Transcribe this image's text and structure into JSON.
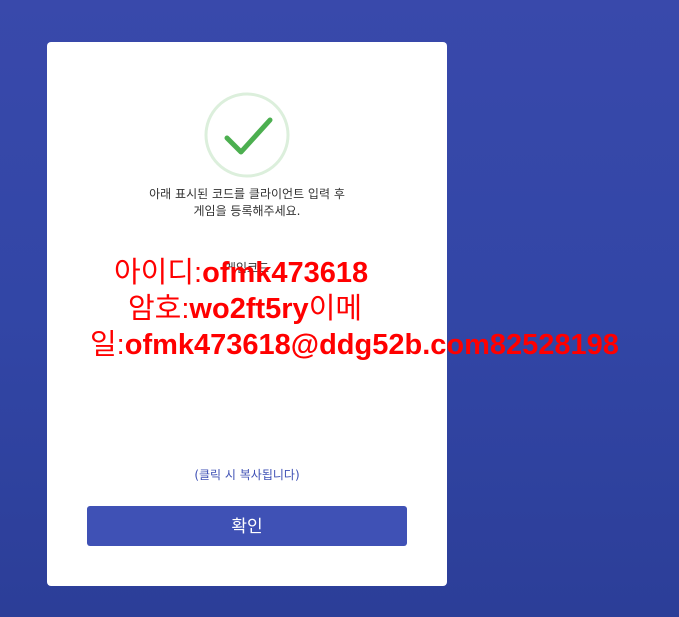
{
  "dialog": {
    "icon": "check-circle-icon",
    "instruction_line1": "아래 표시된 코드를 클라이언트 입력 후",
    "instruction_line2": "게임을 등록해주세요.",
    "code_label": "게임코드",
    "credentials": {
      "id_label": "아이디:",
      "id_value": "ofmk473618",
      "pw_label": "암호:",
      "pw_value": "wo2ft5ry",
      "email_label_part1": "이메",
      "email_label_part2": "일:",
      "email_value": "ofmk473618@ddg52b.com82528198"
    },
    "copy_hint": "(클릭 시 복사됩니다)",
    "confirm_label": "확인"
  },
  "colors": {
    "background": "#3246a6",
    "accent": "#3f51b5",
    "check_green": "#4caf50",
    "check_ring": "#dcefdc",
    "credential_red": "#ff0000"
  }
}
